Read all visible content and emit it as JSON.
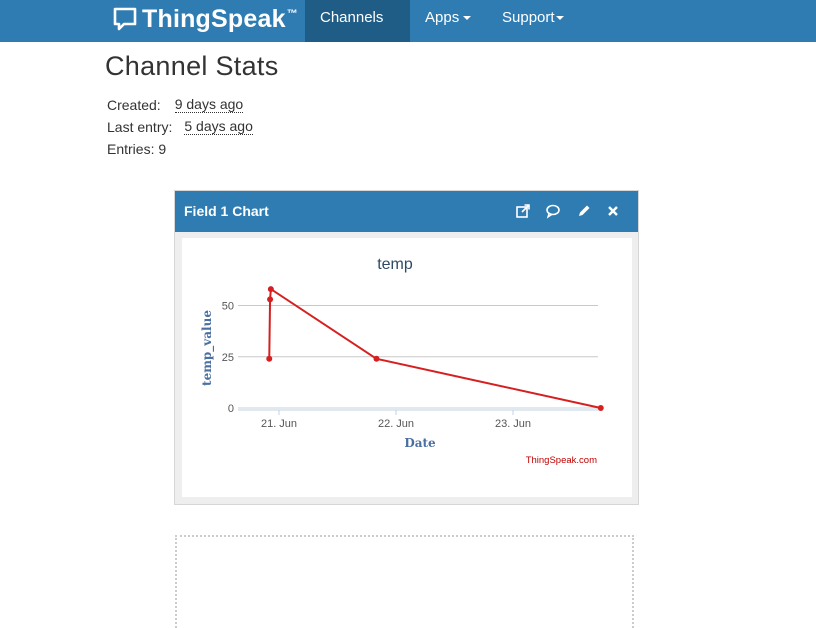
{
  "nav": {
    "brand": "ThingSpeak",
    "brand_tm": "™",
    "items": [
      {
        "label": "Channels",
        "active": true
      },
      {
        "label": "Apps",
        "active": false
      },
      {
        "label": "Support",
        "active": false
      }
    ]
  },
  "page": {
    "title": "Channel Stats"
  },
  "stats": {
    "created_label": "Created:",
    "created_value": "9 days ago",
    "last_entry_label": "Last entry:",
    "last_entry_value": "5 days ago",
    "entries_label": "Entries: 9"
  },
  "panel": {
    "title": "Field 1 Chart",
    "icons": [
      "external-link-icon",
      "comment-icon",
      "pencil-icon",
      "close-icon"
    ]
  },
  "chart_data": {
    "type": "line",
    "title": "temp",
    "xlabel": "Date",
    "ylabel": "temp_value",
    "credit": "ThingSpeak.com",
    "x_ticks": [
      "21. Jun",
      "22. Jun",
      "23. Jun"
    ],
    "y_ticks": [
      "0",
      "25",
      "50"
    ],
    "ylim": [
      0,
      60
    ],
    "series": [
      {
        "color": "#d62020",
        "points": [
          {
            "x": "2017-06-20 22:00",
            "y": 24
          },
          {
            "x": "2017-06-20 22:10",
            "y": 53
          },
          {
            "x": "2017-06-20 22:20",
            "y": 58
          },
          {
            "x": "2017-06-21 20:00",
            "y": 24
          },
          {
            "x": "2017-06-23 18:00",
            "y": 0
          }
        ]
      }
    ]
  }
}
